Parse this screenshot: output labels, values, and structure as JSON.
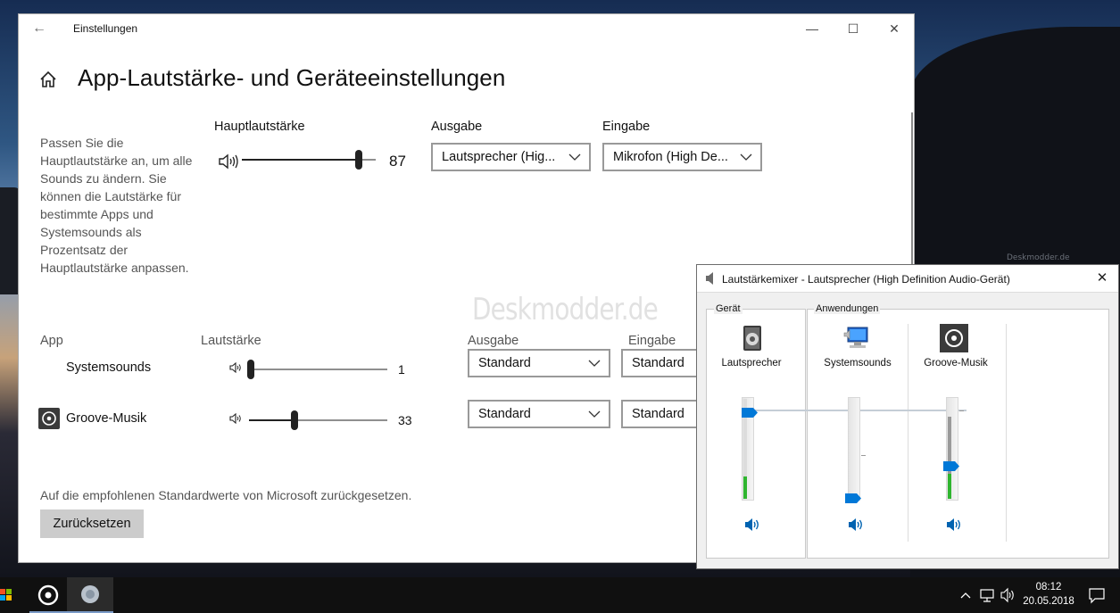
{
  "settings": {
    "window_title": "Einstellungen",
    "page_title": "App-Lautstärke- und Geräteeinstellungen",
    "description": "Passen Sie die Hauptlautstärke an, um alle Sounds zu ändern. Sie können die Lautstärke für bestimmte Apps und Systemsounds als Prozentsatz der Hauptlautstärke anpassen.",
    "master": {
      "label": "Hauptlautstärke",
      "value": "87",
      "level": 0.87
    },
    "output": {
      "label": "Ausgabe",
      "selected": "Lautsprecher (Hig..."
    },
    "input": {
      "label": "Eingabe",
      "selected": "Mikrofon (High De..."
    },
    "table_headers": {
      "app": "App",
      "volume": "Lautstärke",
      "output": "Ausgabe",
      "input": "Eingabe"
    },
    "apps": [
      {
        "name": "Systemsounds",
        "value": "1",
        "level": 0.01,
        "output": "Standard",
        "input": "Standard"
      },
      {
        "name": "Groove-Musik",
        "value": "33",
        "level": 0.33,
        "output": "Standard",
        "input": "Standard"
      }
    ],
    "reset": {
      "text": "Auf die empfohlenen Standardwerte von Microsoft zurückgesetzen.",
      "button": "Zurücksetzen"
    },
    "watermark": "Deskmodder.de"
  },
  "mixer": {
    "title": "Lautstärkemixer - Lautsprecher (High Definition Audio-Gerät)",
    "device_group": "Gerät",
    "apps_group": "Anwendungen",
    "channels": [
      {
        "name": "Lautsprecher",
        "icon": "speaker-device-icon",
        "level": 0.87,
        "meter": 0.22
      },
      {
        "name": "Systemsounds",
        "icon": "system-sounds-icon",
        "level": 0.01,
        "meter": 0
      },
      {
        "name": "Groove-Musik",
        "icon": "groove-music-icon",
        "level": 0.33,
        "meter": 0.25
      }
    ]
  },
  "taskbar": {
    "time": "08:12",
    "date": "20.05.2018"
  },
  "desktop": {
    "watermark": "Deskmodder.de"
  },
  "colors": {
    "accent": "#0078d7",
    "meter_green": "#2fb52f"
  }
}
